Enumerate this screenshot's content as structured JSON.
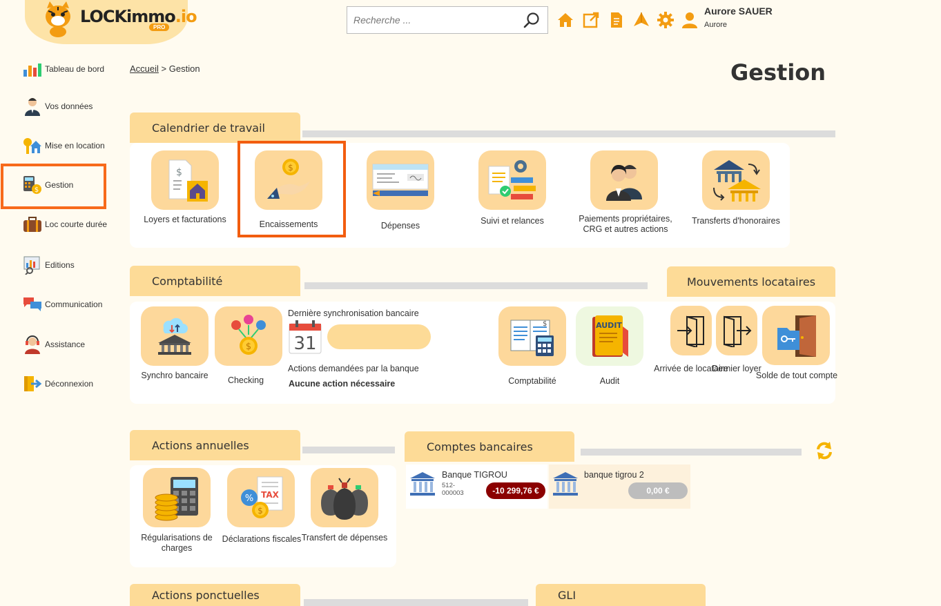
{
  "brand": {
    "name_main": "LOCKimmo",
    "name_suffix": ".io",
    "badge": "PRO"
  },
  "header": {
    "search_placeholder": "Recherche ...",
    "user_name": "Aurore SAUER",
    "user_sub": "Aurore"
  },
  "sidebar": {
    "items": [
      {
        "label": "Tableau de bord",
        "icon": "dashboard-icon"
      },
      {
        "label": "Vos données",
        "icon": "user-icon"
      },
      {
        "label": "Mise en location",
        "icon": "house-key-icon"
      },
      {
        "label": "Gestion",
        "icon": "calculator-icon"
      },
      {
        "label": "Loc courte durée",
        "icon": "suitcase-icon"
      },
      {
        "label": "Editions",
        "icon": "report-icon"
      },
      {
        "label": "Communication",
        "icon": "chat-icon"
      },
      {
        "label": "Assistance",
        "icon": "headset-icon"
      },
      {
        "label": "Déconnexion",
        "icon": "logout-icon"
      }
    ]
  },
  "breadcrumb": {
    "home": "Accueil",
    "sep": ">",
    "current": "Gestion"
  },
  "page_title": "Gestion",
  "calendrier": {
    "title": "Calendrier de travail",
    "tiles": [
      {
        "label": "Loyers et facturations"
      },
      {
        "label": "Encaissements"
      },
      {
        "label": "Dépenses"
      },
      {
        "label": "Suivi et relances"
      },
      {
        "label": "Paiements propriétaires, CRG et autres actions"
      },
      {
        "label": "Transferts d'honoraires"
      }
    ]
  },
  "comptabilite": {
    "title": "Comptabilité",
    "tiles": [
      {
        "label": "Synchro bancaire"
      },
      {
        "label": "Checking"
      },
      {
        "label": "Comptabilité"
      },
      {
        "label": "Audit"
      }
    ],
    "sync_label": "Dernière synchronisation bancaire",
    "calendar_day": "31",
    "actions_label": "Actions demandées par la banque",
    "actions_value": "Aucune action nécessaire",
    "audit_badge": "AUDIT"
  },
  "mouvements": {
    "title": "Mouvements locataires",
    "tiles": [
      {
        "label": "Arrivée de locataire"
      },
      {
        "label": "Dernier loyer"
      },
      {
        "label": "Solde de tout compte"
      }
    ]
  },
  "annuelles": {
    "title": "Actions annuelles",
    "tiles": [
      {
        "label": "Régularisations de charges"
      },
      {
        "label": "Déclarations fiscales"
      },
      {
        "label": "Transfert de dépenses"
      }
    ],
    "tax_text": "TAX",
    "percent_text": "%"
  },
  "comptes": {
    "title": "Comptes bancaires",
    "banks": [
      {
        "name": "Banque TIGROU",
        "number": "512-000003",
        "amount": "-10 299,76 €",
        "color": "#8b0000"
      },
      {
        "name": "banque tigrou 2",
        "number": "",
        "amount": "0,00 €",
        "color": "#bdbdbd"
      }
    ]
  },
  "ponctuelles": {
    "title": "Actions ponctuelles"
  },
  "gli": {
    "title": "GLI"
  },
  "colors": {
    "accent": "#f39c12",
    "tab": "#fddb97",
    "tile": "#fdd89b",
    "highlight": "#f25d0f"
  }
}
